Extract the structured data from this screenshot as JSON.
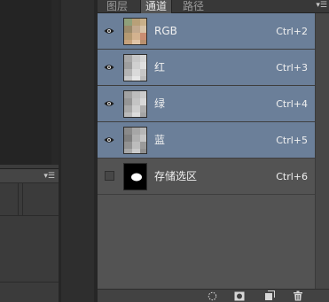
{
  "panel": {
    "tabs": [
      {
        "label": "图层",
        "active": false
      },
      {
        "label": "通道",
        "active": true
      },
      {
        "label": "路径",
        "active": false
      }
    ],
    "menu_icon": "panel-menu-icon"
  },
  "channels": [
    {
      "name": "RGB",
      "shortcut": "Ctrl+2",
      "visible": true,
      "selected": true,
      "thumb": "rgb-thumbnail"
    },
    {
      "name": "红",
      "shortcut": "Ctrl+3",
      "visible": true,
      "selected": true,
      "thumb": "red-thumbnail"
    },
    {
      "name": "绿",
      "shortcut": "Ctrl+4",
      "visible": true,
      "selected": true,
      "thumb": "green-thumbnail"
    },
    {
      "name": "蓝",
      "shortcut": "Ctrl+5",
      "visible": true,
      "selected": true,
      "thumb": "blue-thumbnail"
    },
    {
      "name": "存储选区",
      "shortcut": "Ctrl+6",
      "visible": false,
      "selected": false,
      "thumb": "selection-mask-thumbnail"
    }
  ],
  "bottom_icons": [
    "load-selection-icon",
    "save-selection-icon",
    "new-channel-icon",
    "delete-channel-icon"
  ],
  "colors": {
    "selected_row": "#6b7f99",
    "panel_bg": "#535353",
    "tabbar_bg": "#383838"
  }
}
